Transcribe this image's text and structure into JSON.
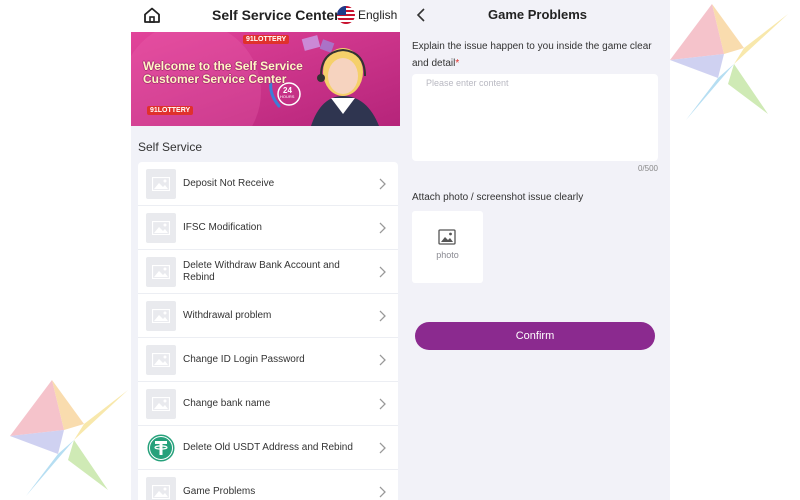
{
  "left_panel": {
    "header": {
      "title": "Self Service Center",
      "language": "English"
    },
    "banner": {
      "headline": "Welcome to the Self Service Customer Service Center",
      "badge": "24",
      "badge_sub": "HOURS",
      "logo_text": "91LOTTERY"
    },
    "section_title": "Self Service",
    "items": [
      {
        "label": "Deposit Not Receive",
        "icon": "image-placeholder-icon"
      },
      {
        "label": "IFSC Modification",
        "icon": "image-placeholder-icon"
      },
      {
        "label": "Delete Withdraw Bank Account and Rebind",
        "icon": "image-placeholder-icon"
      },
      {
        "label": "Withdrawal problem",
        "icon": "image-placeholder-icon"
      },
      {
        "label": "Change ID Login Password",
        "icon": "image-placeholder-icon"
      },
      {
        "label": "Change bank name",
        "icon": "image-placeholder-icon"
      },
      {
        "label": "Delete Old USDT Address and Rebind",
        "icon": "usdt-icon"
      },
      {
        "label": "Game Problems",
        "icon": "image-placeholder-icon"
      }
    ]
  },
  "right_panel": {
    "title": "Game Problems",
    "explain_label": "Explain the issue happen to you inside the game clear and detail",
    "required_mark": "*",
    "input_placeholder": "Please enter content",
    "input_value": "",
    "counter": "0/500",
    "attach_label": "Attach photo / screenshot issue clearly",
    "photo_label": "photo",
    "confirm_label": "Confirm"
  },
  "colors": {
    "accent": "#8b2a8f",
    "banner_bg": "#d6348f",
    "usdt": "#26a17b"
  }
}
